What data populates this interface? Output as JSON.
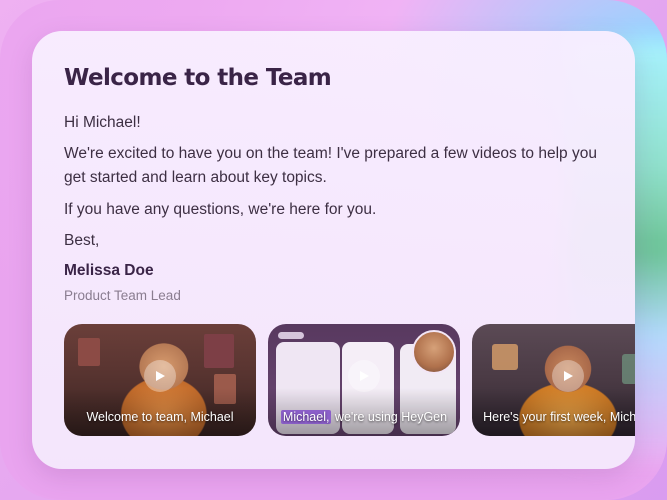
{
  "message": {
    "title": "Welcome to the Team",
    "greeting": "Hi Michael!",
    "paragraph1": "We're excited to have you on the team! I've prepared a few videos to help you get started and learn about key topics.",
    "paragraph2": "If you have any questions, we're here for you.",
    "closing": "Best,",
    "sender_name": "Melissa Doe",
    "sender_role": "Product Team Lead"
  },
  "videos": [
    {
      "caption": "Welcome to team, Michael",
      "icon": "play-icon"
    },
    {
      "caption_highlight": "Michael,",
      "caption_rest": " we're using HeyGen",
      "icon": "play-icon"
    },
    {
      "caption": "Here's your first week, Michael",
      "icon": "play-icon"
    }
  ],
  "colors": {
    "title": "#3a2447",
    "text": "#3d2f43",
    "muted": "#8a7d90",
    "highlight": "#8b5fc9"
  }
}
